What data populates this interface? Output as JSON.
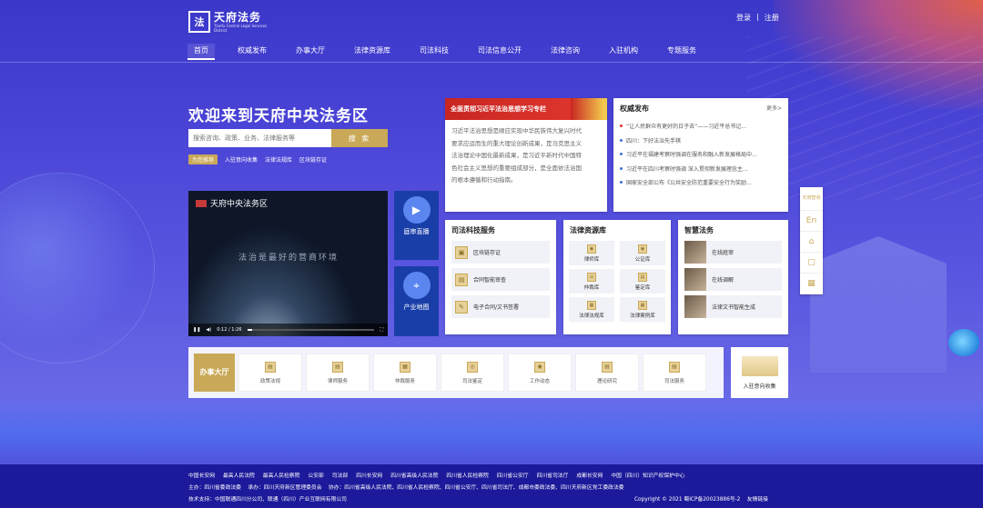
{
  "header": {
    "logo_cn": "天府法务",
    "logo_en": "Tianfu Central Legal Services District",
    "login": "登录",
    "register": "注册",
    "nav": [
      "首页",
      "权威发布",
      "办事大厅",
      "法律资源库",
      "司法科技",
      "司法信息公开",
      "法律咨询",
      "入驻机构",
      "专题服务"
    ]
  },
  "hero": {
    "welcome": "欢迎来到天府中央法务区",
    "search_placeholder": "搜索咨询、政策、业务、法律服务等",
    "search_btn": "搜 索",
    "hot_label": "为您推荐",
    "tags": [
      "入驻意向收集",
      "法律法规库",
      "区块链存证"
    ]
  },
  "video": {
    "title": "天府中央法务区",
    "caption": "法治是最好的营商环境",
    "time": "0:12 / 1:26"
  },
  "tiles": {
    "live": "庭审直播",
    "map": "产业地图"
  },
  "study": {
    "banner": "全面贯彻习近平法治思想学习专栏",
    "lines": [
      "习近平法治思想是顺应实现中华民族伟大复兴时代",
      "要求应运而生的重大理论创新成果，是马克思主义",
      "法治理论中国化最新成果，是习近平新时代中国特",
      "色社会主义思想的重要组成部分，是全面依法治国",
      "的根本遵循和行动指南。"
    ]
  },
  "news": {
    "title": "权威发布",
    "more": "更多>",
    "items": [
      "“让人民群众有更好的日子去”——习近平总书记...",
      "四川：下好法治先手棋",
      "习近平在福建考察时强调在服务和融入新发展格局中...",
      "习近平在四川考察时强调 深入贯彻新发展理念主...",
      "国家安全部公布《公共安全防范重要安全行为奖励..."
    ]
  },
  "tech": {
    "title": "司法科技服务",
    "items": [
      "区块链存证",
      "合同智能审查",
      "电子合同/文书签署"
    ]
  },
  "library": {
    "title": "法律资源库",
    "items": [
      "律师库",
      "公证库",
      "仲裁库",
      "鉴定库",
      "法律法规库",
      "法律案例库"
    ]
  },
  "smart": {
    "title": "智慧法务",
    "items": [
      "在线庭审",
      "在线调解",
      "法律文书智能生成"
    ]
  },
  "side": {
    "consult": "天府智询",
    "en": "En",
    "home": "⌂",
    "chat": "▢",
    "qr": "▦"
  },
  "hall": {
    "badge": "办事大厅",
    "items": [
      "政策法规",
      "律师服务",
      "仲裁服务",
      "司法鉴定",
      "工作动态",
      "理论研究",
      "司法服务"
    ],
    "mgmt": "入驻意向收集"
  },
  "footer": {
    "links": [
      "中国长安网",
      "最高人民法院",
      "最高人民检察院",
      "公安部",
      "司法部",
      "四川长安网",
      "四川省高级人民法院",
      "四川省人民检察院",
      "四川省公安厅",
      "四川省司法厅",
      "成都长安网",
      "中国（四川）知识产权保护中心"
    ],
    "host": "主办：四川省委政法委",
    "organizer": "承办：四川天府新区管理委员会",
    "cohost": "协办：四川省高级人民法院、四川省人民检察院、四川省公安厅、四川省司法厅、成都市委政法委、四川天府新区党工委政法委",
    "tech": "技术支持：中国联通四川分公司、联通（四川）产业互联网有限公司",
    "copyright": "Copyright © 2021 蜀ICP备20023886号-2",
    "friend": "友情链接"
  }
}
